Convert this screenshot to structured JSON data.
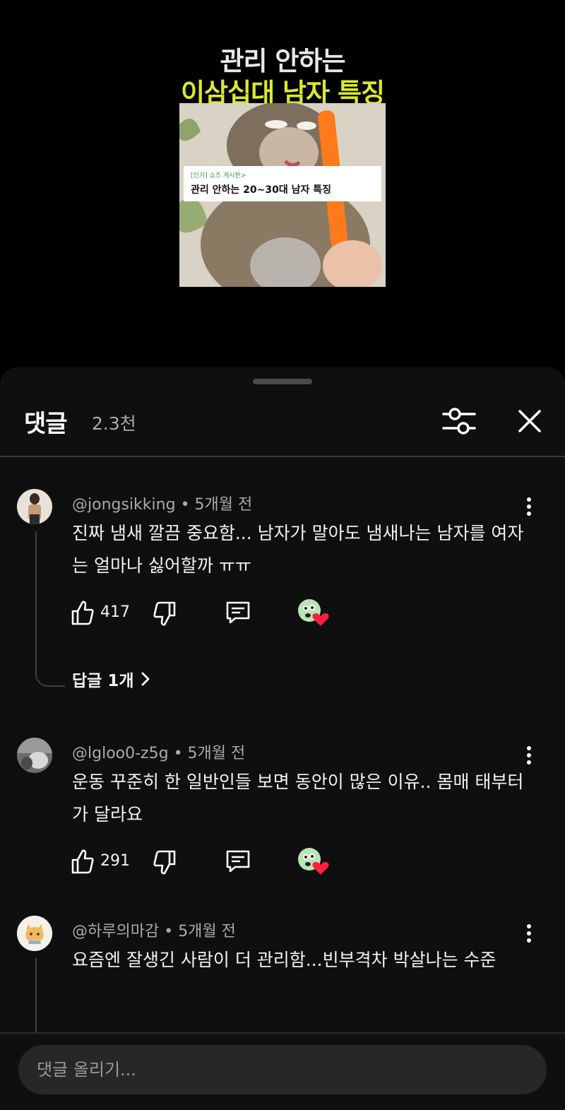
{
  "video": {
    "title_line1": "관리 안하는",
    "title_line2": "이삼십대 남자 특징",
    "thumbnail_tag": "[인기] 쇼츠 게시판>",
    "thumbnail_headline": "관리 안하는 20~30대 남자 특징"
  },
  "sheet": {
    "title": "댓글",
    "count": "2.3천",
    "filter_icon": "filter-sliders-icon",
    "close_icon": "close-icon"
  },
  "comments": [
    {
      "author": "@jongsikking",
      "time": "5개월 전",
      "text": "진짜 냄새 깔끔 중요함... 남자가 말아도 냄새나는 남자를 여자는 얼마나 싫어할까 ㅠㅠ",
      "likes": "417",
      "replies_label": "답글 1개"
    },
    {
      "author": "@lgloo0-z5g",
      "time": "5개월 전",
      "text": "운동 꾸준히 한 일반인들 보면 동안이 많은 이유.. 몸매 태부터가 달라요",
      "likes": "291"
    },
    {
      "author": "@하루의마감",
      "time": "5개월 전",
      "text": "요즘엔 잘생긴 사람이 더 관리함...빈부격차 박살나는 수준"
    }
  ],
  "input": {
    "placeholder": "댓글 올리기..."
  },
  "colors": {
    "background": "#000000",
    "sheet": "#0f0f0f",
    "accent_yellow": "#dbe830",
    "heart": "#ff1f3d",
    "muted_text": "#aaaaaa"
  }
}
